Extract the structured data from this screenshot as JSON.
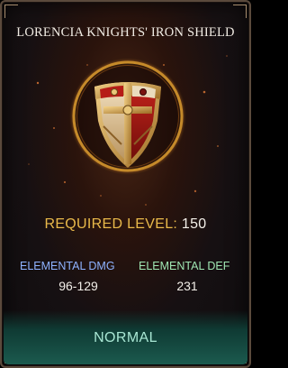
{
  "item": {
    "name": "LORENCIA KNIGHTS' IRON SHIELD",
    "icon": "kite-shield-icon"
  },
  "requirement": {
    "label": "REQUIRED LEVEL:",
    "value": "150"
  },
  "stats": {
    "elemental_dmg": {
      "label": "ELEMENTAL DMG",
      "value": "96-129"
    },
    "elemental_def": {
      "label": "ELEMENTAL DEF",
      "value": "231"
    }
  },
  "grade": "NORMAL",
  "colors": {
    "title": "#f1ece4",
    "required_label": "#e9b94a",
    "dmg_label": "#8fb3ff",
    "def_label": "#9fe6b2",
    "grade": "#a8e6d3",
    "ring": "#c58a2a"
  }
}
